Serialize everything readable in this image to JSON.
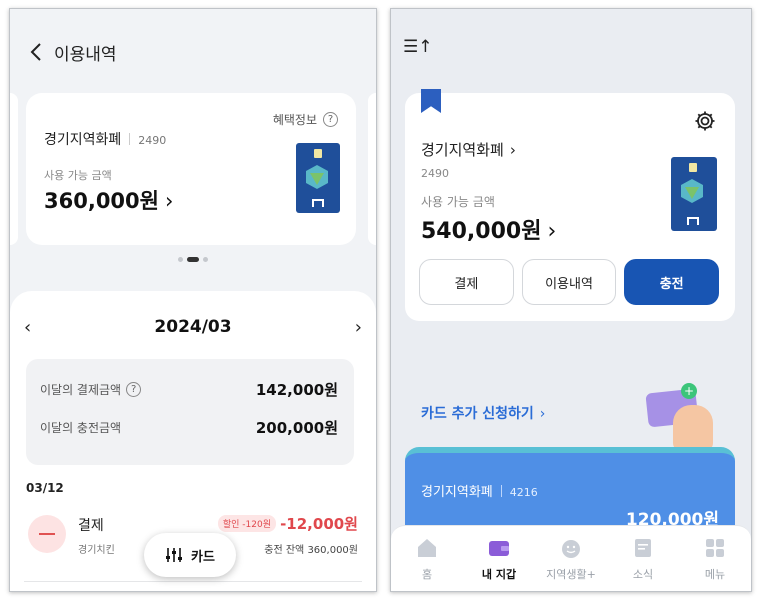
{
  "left": {
    "header": {
      "title": "이용내역"
    },
    "card": {
      "benefit_label": "혜택정보",
      "name": "경기지역화폐",
      "number": "2490",
      "available_label": "사용 가능 금액",
      "amount": "360,000원"
    },
    "month": "2024/03",
    "summary": [
      {
        "label": "이달의 결제금액",
        "value": "142,000원"
      },
      {
        "label": "이달의 충전금액",
        "value": "200,000원"
      }
    ],
    "date_heading": "03/12",
    "transaction": {
      "type": "결제",
      "merchant": "경기치킨",
      "discount": "할인 -120원",
      "amount": "-12,000원",
      "balance": "충전 잔액 360,000원"
    },
    "fab_label": "카드"
  },
  "right": {
    "header": {
      "icon_label": "☰↑"
    },
    "card": {
      "name": "경기지역화폐",
      "number": "2490",
      "available_label": "사용 가능 금액",
      "amount": "540,000원",
      "buttons": [
        "결제",
        "이용내역",
        "충전"
      ]
    },
    "add_card_label": "카드 추가 신청하기",
    "wallet_card": {
      "name": "경기지역화폐",
      "number": "4216",
      "amount": "120,000원"
    },
    "tabs": [
      {
        "label": "홈",
        "icon": "home-icon"
      },
      {
        "label": "내 지갑",
        "icon": "wallet-icon"
      },
      {
        "label": "지역생활+",
        "icon": "local-life-icon"
      },
      {
        "label": "소식",
        "icon": "news-icon"
      },
      {
        "label": "메뉴",
        "icon": "menu-grid-icon"
      }
    ],
    "active_tab": "내 지갑"
  },
  "colors": {
    "primary": "#1855b3",
    "accent_blue": "#2a6cd6",
    "negative": "#e0484d",
    "wallet_card": "#4f8fe6"
  }
}
